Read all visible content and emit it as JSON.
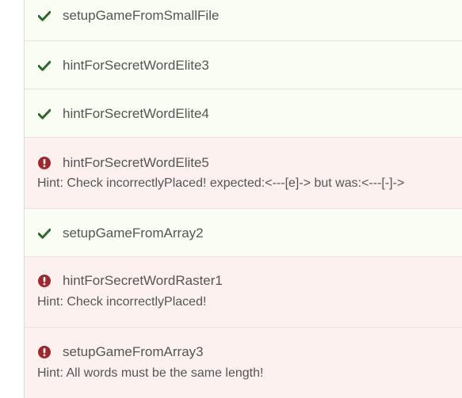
{
  "colors": {
    "pass_icon": "#2e6b2a",
    "fail_icon": "#a0282c",
    "pass_bg": "#f9fdf3",
    "fail_bg": "#fdf1f0",
    "text": "#555555"
  },
  "tests": [
    {
      "status": "pass",
      "icon": "check-icon",
      "name": "setupGameFromSmallFile",
      "hint": ""
    },
    {
      "status": "pass",
      "icon": "check-icon",
      "name": "hintForSecretWordElite3",
      "hint": ""
    },
    {
      "status": "pass",
      "icon": "check-icon",
      "name": "hintForSecretWordElite4",
      "hint": ""
    },
    {
      "status": "fail",
      "icon": "exclamation-circle-icon",
      "name": "hintForSecretWordElite5",
      "hint": "Hint: Check incorrectlyPlaced! expected:<---[e]-> but was:<---[-]->"
    },
    {
      "status": "pass",
      "icon": "check-icon",
      "name": "setupGameFromArray2",
      "hint": ""
    },
    {
      "status": "fail",
      "icon": "exclamation-circle-icon",
      "name": "hintForSecretWordRaster1",
      "hint": "Hint: Check incorrectlyPlaced!"
    },
    {
      "status": "fail",
      "icon": "exclamation-circle-icon",
      "name": "setupGameFromArray3",
      "hint": "Hint: All words must be the same length!"
    }
  ]
}
